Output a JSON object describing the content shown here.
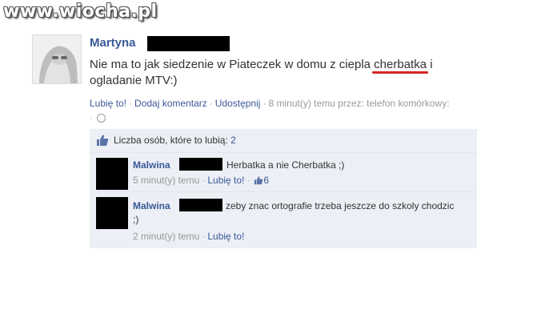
{
  "watermark": "www.wiocha.pl",
  "post": {
    "author": "Martyna",
    "text_before": "Nie ma to jak siedzenie w Piateczek w domu z ciepla ",
    "text_highlight": "cherbatka",
    "text_after": " i ogladanie MTV:)",
    "like_link": "Lubię to!",
    "comment_link": "Dodaj komentarz",
    "share_link": "Udostępnij",
    "time": "8 minut(y) temu przez: telefon komórkowy:",
    "colors": {
      "link": "#3b5998",
      "highlight_underline": "#d42424"
    }
  },
  "comments_section": {
    "likes_label": "Liczba osób, które to lubią:",
    "likes_count": "2",
    "icons": {
      "likes": "thumbs-up-icon",
      "privacy": "globe-icon"
    },
    "comments": [
      {
        "author": "Malwina",
        "text": "Herbatka a nie Cherbatka ;)",
        "time": "5 minut(y) temu",
        "like_link": "Lubię to!",
        "like_count": "6"
      },
      {
        "author": "Malwina",
        "text": "zeby znac ortografie trzeba jeszcze do szkoly chodzic ;)",
        "time": "2 minut(y) temu",
        "like_link": "Lubię to!"
      }
    ]
  }
}
